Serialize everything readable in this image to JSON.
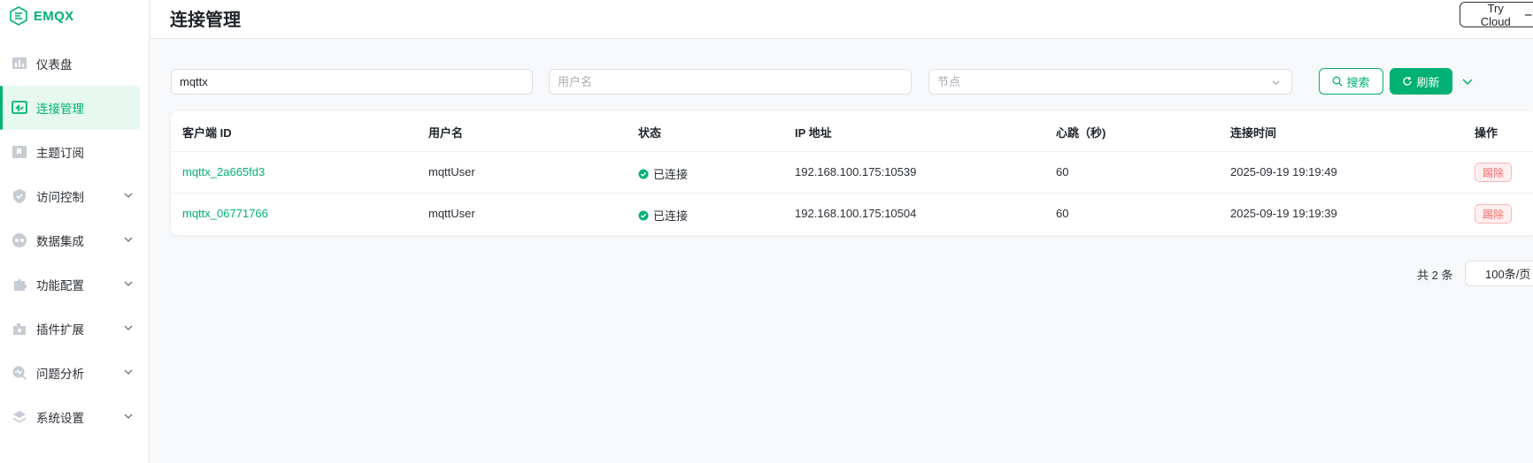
{
  "app": {
    "logo_text": "EMQX"
  },
  "colors": {
    "brand": "#00b173",
    "danger": "#f56c6c",
    "text": "#1f2329"
  },
  "sidebar": {
    "items": [
      {
        "label": "仪表盘",
        "icon": "dashboard-icon",
        "active": false,
        "expandable": false
      },
      {
        "label": "连接管理",
        "icon": "connections-icon",
        "active": true,
        "expandable": false
      },
      {
        "label": "主题订阅",
        "icon": "subscription-icon",
        "active": false,
        "expandable": false
      },
      {
        "label": "访问控制",
        "icon": "shield-icon",
        "active": false,
        "expandable": true
      },
      {
        "label": "数据集成",
        "icon": "integration-icon",
        "active": false,
        "expandable": true
      },
      {
        "label": "功能配置",
        "icon": "puzzle-icon",
        "active": false,
        "expandable": true
      },
      {
        "label": "插件扩展",
        "icon": "plugin-icon",
        "active": false,
        "expandable": true
      },
      {
        "label": "问题分析",
        "icon": "diagnose-icon",
        "active": false,
        "expandable": true
      },
      {
        "label": "系统设置",
        "icon": "layers-icon",
        "active": false,
        "expandable": true
      }
    ]
  },
  "header": {
    "title": "连接管理",
    "try_cloud_label": "Try Cloud"
  },
  "filters": {
    "client_id_value": "mqttx",
    "username_placeholder": "用户名",
    "node_placeholder": "节点",
    "search_label": "搜索",
    "refresh_label": "刷新"
  },
  "table": {
    "columns": [
      "客户端 ID",
      "用户名",
      "状态",
      "IP 地址",
      "心跳（秒)",
      "连接时间",
      "操作"
    ],
    "rows": [
      {
        "client_id": "mqttx_2a665fd3",
        "username": "mqttUser",
        "status": "已连接",
        "ip": "192.168.100.175:10539",
        "keepalive": "60",
        "connected_at": "2025-09-19 19:19:49",
        "action": "踢除"
      },
      {
        "client_id": "mqttx_06771766",
        "username": "mqttUser",
        "status": "已连接",
        "ip": "192.168.100.175:10504",
        "keepalive": "60",
        "connected_at": "2025-09-19 19:19:39",
        "action": "踢除"
      }
    ]
  },
  "pagination": {
    "total_text": "共 2 条",
    "page_size": "100条/页"
  }
}
